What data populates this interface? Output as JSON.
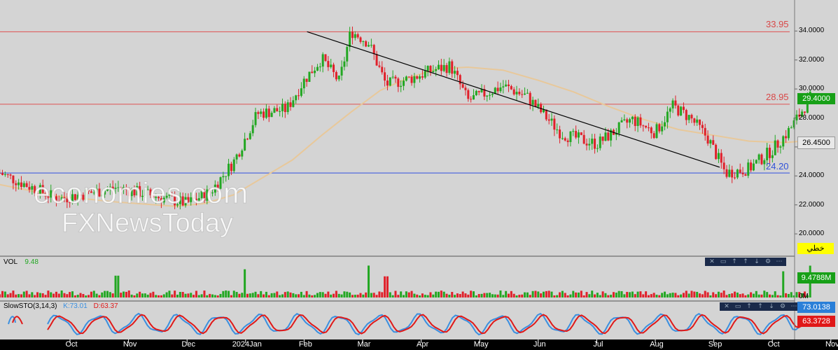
{
  "colors": {
    "background": "#d4d4d4",
    "up_candle": "#22a722",
    "down_candle": "#e0202a",
    "resistance_line": "#e05050",
    "support_line": "#3050e0",
    "trendline": "#000000",
    "moving_average": "#e8c89a",
    "stoch_k": "#3a8fe0",
    "stoch_d": "#e01818",
    "axis_bar": "#000000"
  },
  "watermark": {
    "line1": "economies.com",
    "line2": "FXNewsToday"
  },
  "price_axis": {
    "ticks": [
      "34.0000",
      "32.0000",
      "30.0000",
      "28.0000",
      "26.0000",
      "24.0000",
      "22.0000",
      "20.0000"
    ],
    "current_price": "29.4000",
    "secondary_price": "26.4500",
    "line_tool_label": "خطي"
  },
  "levels": [
    {
      "label": "33.95",
      "value": 33.95
    },
    {
      "label": "28.95",
      "value": 28.95
    },
    {
      "label": "24.20",
      "value": 24.2
    }
  ],
  "volume": {
    "label": "VOL",
    "value": "9.48",
    "axis_value": "9.4788M",
    "axis_zero": "0M"
  },
  "stochastic": {
    "label": "SlowSTO(3,14,3)",
    "k_label": "K:73.01",
    "d_label": "D:63.37",
    "k_value": "73.0138",
    "d_value": "63.3728"
  },
  "toolbar_icons": [
    "close-icon",
    "restore-icon",
    "move-up-icon",
    "move-up-icon",
    "move-down-icon",
    "settings-icon",
    "more-icon"
  ],
  "toolbar_glyphs": [
    "✕",
    "▭",
    "↑",
    "↑",
    "↓",
    "⚙",
    "⋯"
  ],
  "x_axis": {
    "months": [
      "Oct",
      "Nov",
      "Dec",
      "2024Jan",
      "Feb",
      "Mar",
      "Apr",
      "May",
      "Jun",
      "Jul",
      "Aug",
      "Sep",
      "Oct",
      "Nov"
    ]
  },
  "chart_data": {
    "type": "candlestick",
    "x_axis_months": [
      "Oct",
      "Nov",
      "Dec",
      "2024Jan",
      "Feb",
      "Mar",
      "Apr",
      "May",
      "Jun",
      "Jul",
      "Aug",
      "Sep",
      "Oct",
      "Nov"
    ],
    "ylim": [
      19.0,
      35.2
    ],
    "y_ticks": [
      20,
      22,
      24,
      26,
      28,
      30,
      32,
      34
    ],
    "horizontal_levels": [
      33.95,
      28.95,
      24.2
    ],
    "trendline": {
      "from": {
        "month_index": 5.25,
        "price": 33.95
      },
      "to": {
        "month_index": 12.3,
        "price": 24.6
      }
    },
    "price_path": [
      [
        0,
        24.2
      ],
      [
        1,
        22.4
      ],
      [
        2,
        23.2
      ],
      [
        3.2,
        22.1
      ],
      [
        3.6,
        22.9
      ],
      [
        4,
        25.0
      ],
      [
        4.4,
        28.3
      ],
      [
        4.9,
        28.6
      ],
      [
        5.2,
        30.6
      ],
      [
        5.5,
        32.1
      ],
      [
        5.8,
        30.5
      ],
      [
        6,
        34.0
      ],
      [
        6.3,
        33.2
      ],
      [
        6.6,
        30.3
      ],
      [
        7,
        30.7
      ],
      [
        7.4,
        31.3
      ],
      [
        7.7,
        31.6
      ],
      [
        8,
        29.2
      ],
      [
        8.6,
        30.2
      ],
      [
        9,
        29.5
      ],
      [
        9.6,
        26.9
      ],
      [
        10.2,
        26.2
      ],
      [
        10.8,
        27.9
      ],
      [
        11.2,
        27.0
      ],
      [
        11.5,
        28.8
      ],
      [
        11.8,
        28.0
      ],
      [
        12.1,
        26.6
      ],
      [
        12.4,
        24.2
      ],
      [
        12.8,
        24.5
      ],
      [
        13.2,
        25.8
      ],
      [
        13.5,
        27.2
      ],
      [
        13.85,
        29.4
      ]
    ],
    "moving_average_path": [
      [
        0,
        23.4
      ],
      [
        1,
        22.6
      ],
      [
        2,
        22.2
      ],
      [
        3,
        21.9
      ],
      [
        3.5,
        22.1
      ],
      [
        4,
        22.7
      ],
      [
        4.5,
        23.9
      ],
      [
        5,
        25.1
      ],
      [
        5.5,
        26.8
      ],
      [
        6,
        28.4
      ],
      [
        6.5,
        29.9
      ],
      [
        7,
        30.8
      ],
      [
        7.5,
        31.4
      ],
      [
        8,
        31.5
      ],
      [
        8.6,
        31.3
      ],
      [
        9.2,
        30.6
      ],
      [
        9.8,
        29.8
      ],
      [
        10.4,
        28.8
      ],
      [
        11,
        27.9
      ],
      [
        11.6,
        27.2
      ],
      [
        12.2,
        26.8
      ],
      [
        12.8,
        26.4
      ],
      [
        13.4,
        26.3
      ],
      [
        13.85,
        26.45
      ]
    ],
    "current_price": 29.4,
    "moving_average_last": 26.45,
    "volume": {
      "latest": 9.48,
      "unit": "M",
      "spikes": [
        {
          "month_index": 2.0,
          "value": 6.5
        },
        {
          "month_index": 4.2,
          "value": 8.4
        },
        {
          "month_index": 6.3,
          "value": 9.5
        },
        {
          "month_index": 6.6,
          "value": 6.3
        },
        {
          "month_index": 13.4,
          "value": 7.8
        },
        {
          "month_index": 13.85,
          "value": 9.48
        }
      ]
    },
    "stochastic": {
      "k": 73.01,
      "d": 63.37,
      "range": [
        0,
        100
      ]
    }
  }
}
